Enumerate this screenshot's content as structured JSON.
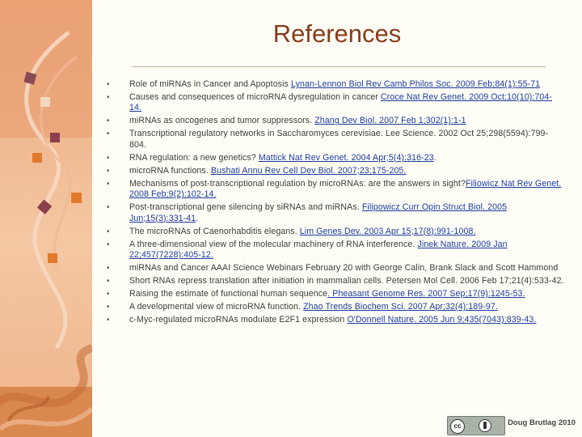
{
  "title": "References",
  "footer": {
    "author": "Doug Brutlag 2010",
    "license_badge": "cc-by-icon",
    "cc_text": "cc"
  },
  "colors": {
    "title": "#8a3a1a",
    "link": "#1a3aa0",
    "panel_top": "#e8a070",
    "panel_mid": "#f3c6a0",
    "panel_bottom": "#d97c4a"
  },
  "references": [
    {
      "text": "Role of miRNAs in Cancer and Apoptosis ",
      "link": "Lynan-Lennon Biol Rev Camb Philos Soc. 2009 Feb;84(1):55-71",
      "after": ""
    },
    {
      "text": "Causes and consequences of microRNA dysregulation in cancer ",
      "link": "Croce Nat Rev Genet. 2009 Oct;10(10):704-14.",
      "after": ""
    },
    {
      "text": "miRNAs as oncogenes and tumor suppressors. ",
      "link": "Zhang Dev Biol. 2007 Feb 1;302(1):1-1",
      "after": ""
    },
    {
      "text": "Transcriptional regulatory networks in Saccharomyces cerevisiae. Lee Science. 2002 Oct 25;298(5594):799-804.",
      "link": "",
      "after": ""
    },
    {
      "text": "RNA regulation: a new genetics? ",
      "link": "Mattick Nat Rev Genet. 2004 Apr;5(4):316-23",
      "after": "."
    },
    {
      "text": "microRNA functions. ",
      "link": "Bushati Annu Rev Cell Dev Biol. 2007;23:175-205.",
      "after": ""
    },
    {
      "text": "Mechanisms of post-transcriptional regulation by microRNAs: are the answers in sight?",
      "link": "Filiowicz Nat Rev Genet. 2008 Feb;9(2):102-14.",
      "after": ""
    },
    {
      "text": "Post-transcriptional gene silencing by siRNAs and miRNAs. ",
      "link": "Filipowicz Curr Opin Struct Biol. 2005 Jun;15(3):331-41",
      "after": "."
    },
    {
      "text": "The microRNAs of Caenorhabditis elegans. ",
      "link": "Lim Genes Dev. 2003 Apr 15;17(8):991-1008.",
      "after": ""
    },
    {
      "text": "A three-dimensional view of the molecular machinery of RNA interference. ",
      "link": "Jinek Nature. 2009 Jan 22;457(7228):405-12.",
      "after": ""
    },
    {
      "text": "miRNAs and Cancer AAAI Science Webinars February 20 with George Calin, Brank Slack and Scott Hammond",
      "link": "",
      "after": ""
    },
    {
      "text": "Short RNAs repress translation after initiation in mammalian cells. Petersen Mol Cell. 2006 Feb 17;21(4):533-42.",
      "link": "",
      "after": ""
    },
    {
      "text": "Raising the estimate of functional human sequence",
      "link": ". Pheasant Genome Res. 2007 Sep;17(9):1245-53.",
      "after": ""
    },
    {
      "text": "A developmental view of microRNA function. ",
      "link": "Zhao Trends Biochem Sci. 2007 Apr;32(4):189-97.",
      "after": ""
    },
    {
      "text": "c-Myc-regulated microRNAs modulate E2F1 expression ",
      "link": "O'Donnell Nature. 2005 Jun 9;435(7043):839-43.",
      "after": ""
    }
  ]
}
